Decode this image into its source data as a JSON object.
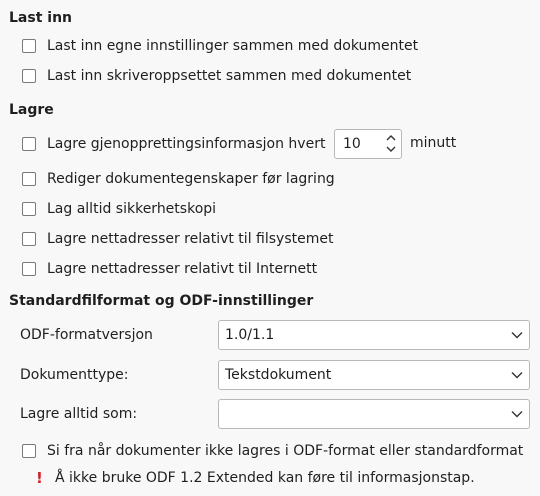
{
  "load": {
    "heading": "Last inn",
    "items": [
      {
        "label": "Last inn egne innstillinger sammen med dokumentet",
        "checked": false
      },
      {
        "label": "Last inn skriveroppsettet sammen med dokumentet",
        "checked": false
      }
    ]
  },
  "save": {
    "heading": "Lagre",
    "autorecovery": {
      "label": "Lagre gjenopprettingsinformasjon hvert",
      "value": "10",
      "unit": "minutt",
      "checked": false
    },
    "items": [
      {
        "label": "Rediger dokumentegenskaper før lagring",
        "checked": false
      },
      {
        "label": "Lag alltid sikkerhetskopi",
        "checked": false
      },
      {
        "label": "Lagre nettadresser relativt til filsystemet",
        "checked": false
      },
      {
        "label": "Lagre nettadresser relativt til Internett",
        "checked": false
      }
    ]
  },
  "formats": {
    "heading": "Standardfilformat og ODF-innstillinger",
    "odf_version": {
      "label": "ODF-formatversjon",
      "value": "1.0/1.1"
    },
    "doc_type": {
      "label": "Dokumenttype:",
      "value": "Tekstdokument"
    },
    "always_save_as": {
      "label": "Lagre alltid som:",
      "value": ""
    },
    "warn_not_odf": {
      "label": "Si fra når dokumenter ikke lagres i ODF-format eller standardformat",
      "checked": false
    },
    "warning": {
      "icon": "exclamation-icon",
      "text": "Å ikke bruke ODF 1.2 Extended kan føre til informasjonstap.",
      "color": "#d0202a"
    }
  }
}
